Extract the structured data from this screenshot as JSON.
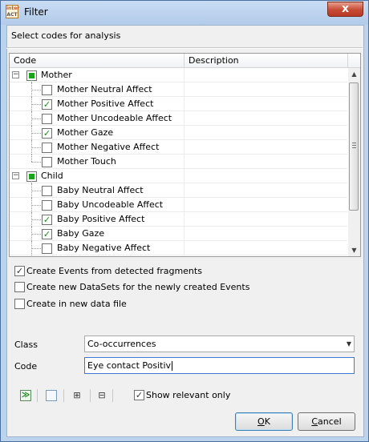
{
  "window": {
    "title": "Filter",
    "app_icon_top": "inter",
    "app_icon_bottom": "ACT",
    "close_glyph": "x"
  },
  "prompt": "Select codes for analysis",
  "columns": {
    "code": "Code",
    "description": "Description"
  },
  "tree": {
    "groups": [
      {
        "label": "Mother",
        "expanded": true,
        "state": "partial",
        "items": [
          {
            "label": "Mother Neutral Affect",
            "checked": false
          },
          {
            "label": "Mother Positive Affect",
            "checked": true
          },
          {
            "label": "Mother Uncodeable Affect",
            "checked": false
          },
          {
            "label": "Mother Gaze",
            "checked": true
          },
          {
            "label": "Mother Negative Affect",
            "checked": false
          },
          {
            "label": "Mother Touch",
            "checked": false
          }
        ]
      },
      {
        "label": "Child",
        "expanded": true,
        "state": "partial",
        "items": [
          {
            "label": "Baby Neutral Affect",
            "checked": false
          },
          {
            "label": "Baby Uncodeable Affect",
            "checked": false
          },
          {
            "label": "Baby Positive Affect",
            "checked": true
          },
          {
            "label": "Baby Gaze",
            "checked": true
          },
          {
            "label": "Baby Negative Affect",
            "checked": false
          }
        ]
      }
    ]
  },
  "options": [
    {
      "label": "Create Events from detected fragments",
      "checked": true
    },
    {
      "label": "Create new DataSets for the newly created Events",
      "checked": false
    },
    {
      "label": "Create in new data file",
      "checked": false
    }
  ],
  "form": {
    "class_label": "Class",
    "class_value": "Co-occurrences",
    "code_label": "Code",
    "code_value": "Eye contact Positiv"
  },
  "toolbar": {
    "check_all_icon": "check-all-icon",
    "uncheck_all_icon": "uncheck-all-icon",
    "expand_all_icon": "expand-all-icon",
    "collapse_all_icon": "collapse-all-icon",
    "show_relevant_label": "Show relevant only",
    "show_relevant_checked": true
  },
  "buttons": {
    "ok_mnemonic": "O",
    "ok_rest": "K",
    "cancel_mnemonic": "C",
    "cancel_rest": "ancel"
  }
}
